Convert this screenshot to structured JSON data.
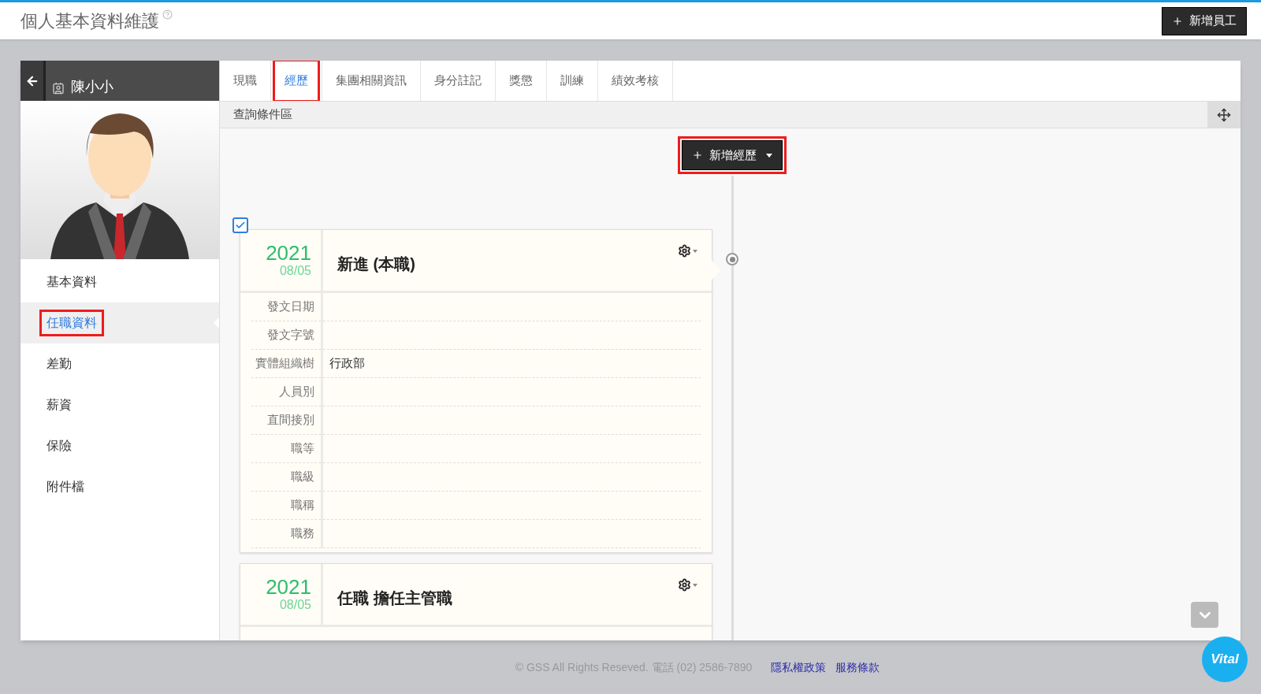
{
  "page": {
    "title": "個人基本資料維護",
    "add_employee_button": "新增員工"
  },
  "employee": {
    "name": "陳小小"
  },
  "tabs": [
    {
      "label": "現職",
      "selected": false,
      "highlighted": false
    },
    {
      "label": "經歷",
      "selected": true,
      "highlighted": true
    },
    {
      "label": "集團相關資訊",
      "selected": false,
      "highlighted": false
    },
    {
      "label": "身分註記",
      "selected": false,
      "highlighted": false
    },
    {
      "label": "獎懲",
      "selected": false,
      "highlighted": false
    },
    {
      "label": "訓練",
      "selected": false,
      "highlighted": false
    },
    {
      "label": "績效考核",
      "selected": false,
      "highlighted": false
    }
  ],
  "nav": [
    {
      "label": "基本資料",
      "selected": false,
      "highlighted": false
    },
    {
      "label": "任職資料",
      "selected": true,
      "highlighted": true
    },
    {
      "label": "差勤",
      "selected": false,
      "highlighted": false
    },
    {
      "label": "薪資",
      "selected": false,
      "highlighted": false
    },
    {
      "label": "保險",
      "selected": false,
      "highlighted": false
    },
    {
      "label": "附件檔",
      "selected": false,
      "highlighted": false
    }
  ],
  "query_bar": {
    "label": "查詢條件區"
  },
  "add_record_button": {
    "label": "新增經歷",
    "highlighted": true
  },
  "timeline_checkbox": {
    "checked": true
  },
  "records": [
    {
      "year": "2021",
      "date": "08/05",
      "title": "新進 (本職)",
      "fields": [
        {
          "label": "發文日期"
        },
        {
          "label": "發文字號"
        },
        {
          "label": "實體組織樹",
          "value": "行政部"
        },
        {
          "label": "人員別"
        },
        {
          "label": "直間接別"
        },
        {
          "label": "職等"
        },
        {
          "label": "職級"
        },
        {
          "label": "職稱"
        },
        {
          "label": "職務"
        }
      ]
    },
    {
      "year": "2021",
      "date": "08/05",
      "title": "任職 擔任主管職"
    }
  ],
  "footer": {
    "copyright": "© GSS All Rights Reseved. 電話 (02) 2586-7890",
    "links": [
      "隱私權政策",
      "服務條款"
    ]
  },
  "vital_badge": {
    "label": "Vital"
  }
}
